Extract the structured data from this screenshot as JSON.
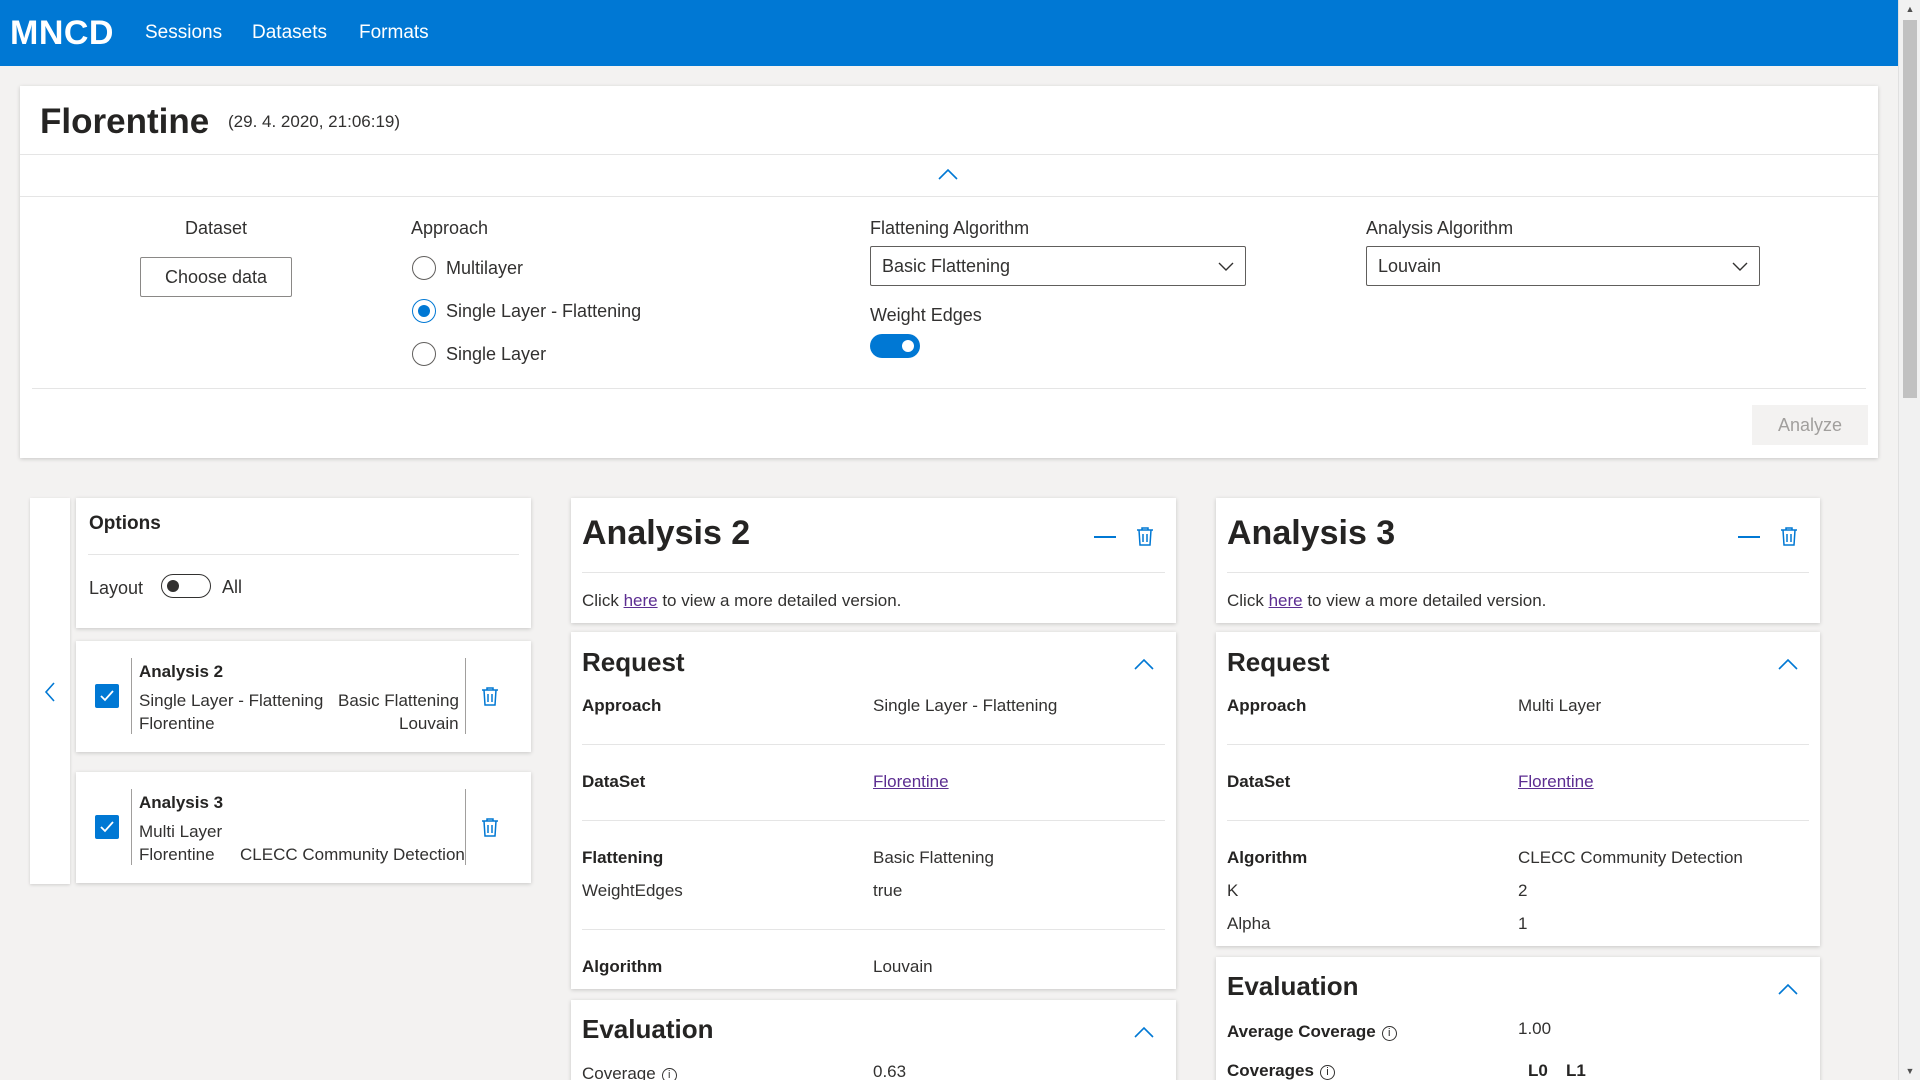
{
  "topbar": {
    "brand": "MNCD",
    "nav": [
      "Sessions",
      "Datasets",
      "Formats"
    ]
  },
  "session": {
    "title": "Florentine",
    "date": "(29. 4. 2020, 21:06:19)",
    "dataset_label": "Dataset",
    "choose_data_button": "Choose data",
    "approach_label": "Approach",
    "approach_options": [
      "Multilayer",
      "Single Layer - Flattening",
      "Single Layer"
    ],
    "approach_selected": "Single Layer - Flattening",
    "flattening_label": "Flattening Algorithm",
    "flattening_value": "Basic Flattening",
    "weight_edges_label": "Weight Edges",
    "weight_edges_on": true,
    "analysis_algorithm_label": "Analysis Algorithm",
    "analysis_algorithm_value": "Louvain",
    "analyze_button": "Analyze"
  },
  "options": {
    "title": "Options",
    "layout_label": "Layout",
    "layout_value": "All",
    "layout_on": false
  },
  "analysis_list": [
    {
      "title": "Analysis 2",
      "checked": true,
      "approach": "Single Layer - Flattening",
      "flattening": "Basic Flattening",
      "dataset": "Florentine",
      "algorithm": "Louvain"
    },
    {
      "title": "Analysis 3",
      "checked": true,
      "approach": "Multi Layer",
      "dataset": "Florentine",
      "algorithm": "CLECC Community Detection"
    }
  ],
  "detail_prefix": "Click ",
  "detail_link": "here",
  "detail_suffix": " to view a more detailed version.",
  "analysis2": {
    "title": "Analysis 2",
    "request_title": "Request",
    "rows": {
      "approach_label": "Approach",
      "approach_value": "Single Layer - Flattening",
      "dataset_label": "DataSet",
      "dataset_value": "Florentine",
      "flattening_label": "Flattening",
      "flattening_value": "Basic Flattening",
      "weightedges_label": "WeightEdges",
      "weightedges_value": "true",
      "algorithm_label": "Algorithm",
      "algorithm_value": "Louvain"
    },
    "evaluation_title": "Evaluation",
    "coverage_label": "Coverage",
    "coverage_value": "0.63"
  },
  "analysis3": {
    "title": "Analysis 3",
    "request_title": "Request",
    "rows": {
      "approach_label": "Approach",
      "approach_value": "Multi Layer",
      "dataset_label": "DataSet",
      "dataset_value": "Florentine",
      "algorithm_label": "Algorithm",
      "algorithm_value": "CLECC Community Detection",
      "k_label": "K",
      "k_value": "2",
      "alpha_label": "Alpha",
      "alpha_value": "1"
    },
    "evaluation_title": "Evaluation",
    "avg_coverage_label": "Average Coverage",
    "avg_coverage_value": "1.00",
    "coverages_label": "Coverages",
    "coverages_headers": [
      "L0",
      "L1"
    ]
  },
  "colors": {
    "brand_blue": "#0078d4",
    "link_purple": "#5c2d91",
    "page_bg": "#f3f2f1"
  }
}
